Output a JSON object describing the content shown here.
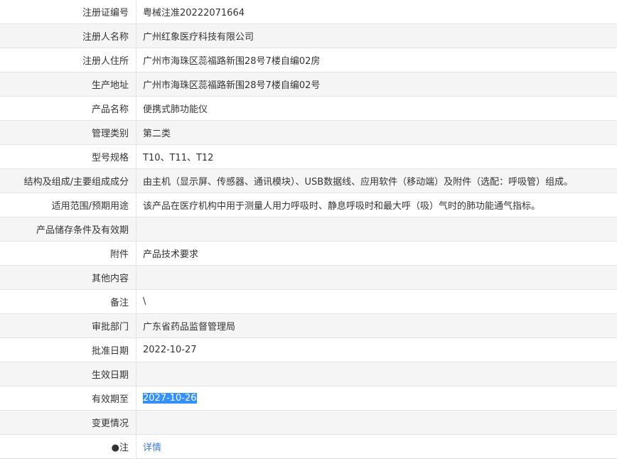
{
  "rows": [
    {
      "label": "注册证编号",
      "value": "粤械注准20222071664"
    },
    {
      "label": "注册人名称",
      "value": "广州红象医疗科技有限公司"
    },
    {
      "label": "注册人住所",
      "value": "广州市海珠区蕊福路新围28号7楼自编02房"
    },
    {
      "label": "生产地址",
      "value": "广州市海珠区蕊福路新围28号7楼自编02号"
    },
    {
      "label": "产品名称",
      "value": "便携式肺功能仪"
    },
    {
      "label": "管理类别",
      "value": "第二类"
    },
    {
      "label": "型号规格",
      "value": "T10、T11、T12"
    },
    {
      "label": "结构及组成/主要组成成分",
      "value": "由主机（显示屏、传感器、通讯模块）、USB数据线、应用软件（移动端）及附件（选配：呼吸管）组成。"
    },
    {
      "label": "适用范围/预期用途",
      "value": "该产品在医疗机构中用于测量人用力呼吸时、静息呼吸时和最大呼（吸）气时的肺功能通气指标。"
    },
    {
      "label": "产品储存条件及有效期",
      "value": ""
    },
    {
      "label": "附件",
      "value": "产品技术要求"
    },
    {
      "label": "其他内容",
      "value": ""
    },
    {
      "label": "备注",
      "value": "\\"
    },
    {
      "label": "审批部门",
      "value": "广东省药品监督管理局"
    },
    {
      "label": "批准日期",
      "value": "2022-10-27"
    },
    {
      "label": "生效日期",
      "value": ""
    },
    {
      "label": "有效期至",
      "value": "2027-10-26"
    },
    {
      "label": "变更情况",
      "value": ""
    },
    {
      "label": "●注",
      "value": "详情"
    }
  ]
}
